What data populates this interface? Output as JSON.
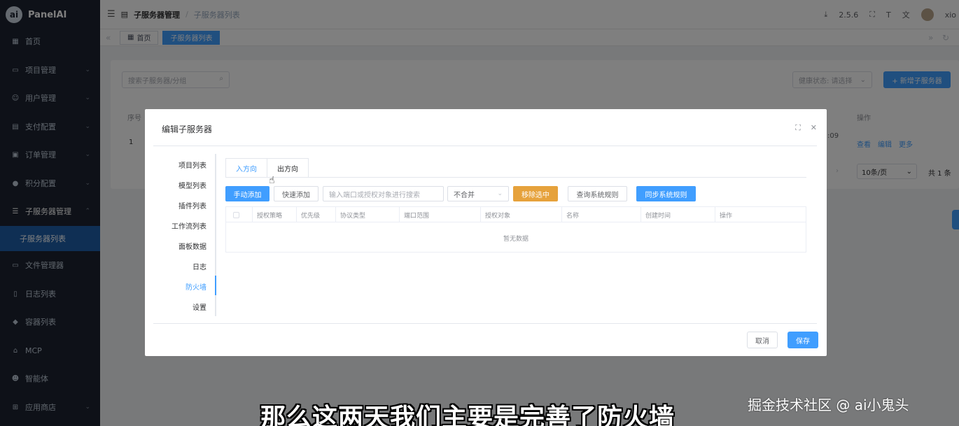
{
  "app": {
    "logo_text": "PanelAI",
    "logo_mark": "ai"
  },
  "sidebar": {
    "items": [
      {
        "label": "首页",
        "icon": "dashboard-icon"
      },
      {
        "label": "项目管理",
        "icon": "project-icon"
      },
      {
        "label": "用户管理",
        "icon": "users-icon"
      },
      {
        "label": "支付配置",
        "icon": "payment-icon"
      },
      {
        "label": "订单管理",
        "icon": "order-icon"
      },
      {
        "label": "积分配置",
        "icon": "points-icon"
      },
      {
        "label": "子服务器管理",
        "icon": "server-icon"
      },
      {
        "label": "子服务器列表",
        "icon": ""
      },
      {
        "label": "文件管理器",
        "icon": "folder-icon"
      },
      {
        "label": "日志列表",
        "icon": "log-icon"
      },
      {
        "label": "容器列表",
        "icon": "container-icon"
      },
      {
        "label": "MCP",
        "icon": "mcp-icon"
      },
      {
        "label": "智能体",
        "icon": "agent-icon"
      },
      {
        "label": "应用商店",
        "icon": "store-icon"
      }
    ]
  },
  "topbar": {
    "breadcrumb_parent": "子服务器管理",
    "breadcrumb_sep": "/",
    "breadcrumb_current": "子服务器列表",
    "version": "2.5.6",
    "user": "xio"
  },
  "tags": {
    "home": "首页",
    "current": "子服务器列表"
  },
  "main": {
    "search_placeholder": "搜索子服务器/分组",
    "health_placeholder": "健康状态: 请选择",
    "add_button": "+ 新增子服务器",
    "col_seq": "序号",
    "row_seq": "1",
    "col_ops": "操作",
    "row_time_fragment": ":09",
    "row_view": "查看",
    "row_edit": "编辑",
    "row_more": "更多",
    "page_size": "10条/页",
    "total": "共 1 条"
  },
  "dialog": {
    "title": "编辑子服务器",
    "vtabs": [
      "项目列表",
      "模型列表",
      "插件列表",
      "工作流列表",
      "面板数据",
      "日志",
      "防火墙",
      "设置"
    ],
    "active_vtab": "防火墙",
    "htabs": [
      "入方向",
      "出方向"
    ],
    "active_htab": "入方向",
    "btn_manual_add": "手动添加",
    "btn_quick_add": "快速添加",
    "search_placeholder": "输入端口或授权对象进行搜索",
    "merge_select": "不合并",
    "btn_remove_selected": "移除选中",
    "btn_query_rules": "查询系统规则",
    "btn_sync_rules": "同步系统规则",
    "columns": [
      "授权策略",
      "优先级",
      "协议类型",
      "端口范围",
      "授权对象",
      "名称",
      "创建时间",
      "操作"
    ],
    "empty_text": "暂无数据",
    "btn_cancel": "取消",
    "btn_save": "保存"
  },
  "overlay_text": {
    "subtitle": "那么这两天我们主要是完善了防火墙",
    "watermark": "掘金技术社区 @ ai小鬼头"
  },
  "colors": {
    "primary": "#409eff",
    "warning": "#e6a23c",
    "sidebar_bg": "#1d2330",
    "sidebar_active": "#1e5ea8"
  }
}
